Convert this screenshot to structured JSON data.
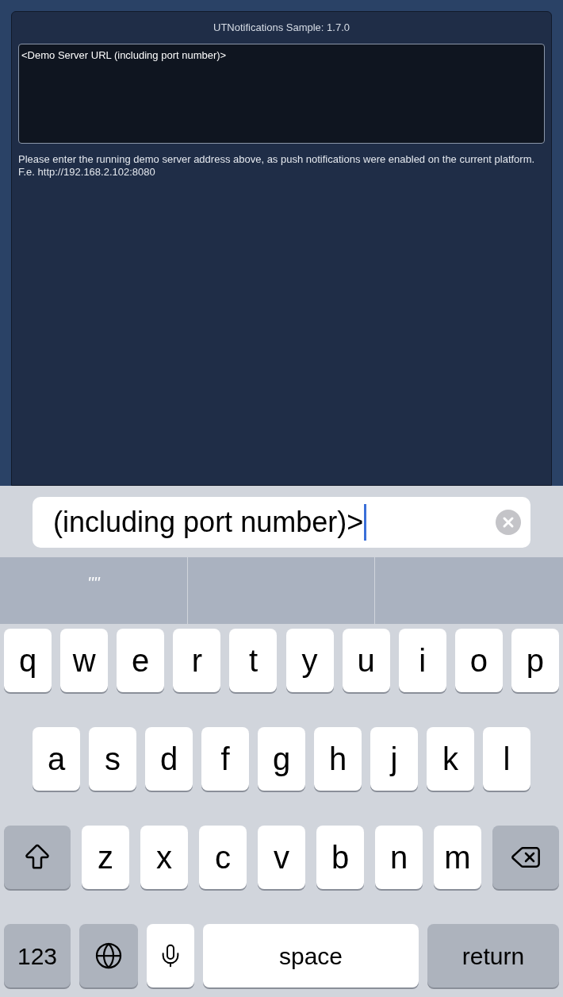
{
  "window": {
    "title": "UTNotifications Sample: 1.7.0"
  },
  "server_field": {
    "value": "<Demo Server URL (including port number)>"
  },
  "hint": "Please enter the running demo server address above, as push notifications were enabled on the current platform. F.e. http://192.168.2.102:8080",
  "keyboard_input": {
    "value": "(including port number)>",
    "focused": true
  },
  "suggestions": [
    "\"\""
  ],
  "keys": [
    [
      {
        "kind": "letter",
        "label": "q"
      },
      {
        "kind": "letter",
        "label": "w"
      },
      {
        "kind": "letter",
        "label": "e"
      },
      {
        "kind": "letter",
        "label": "r"
      },
      {
        "kind": "letter",
        "label": "t"
      },
      {
        "kind": "letter",
        "label": "y"
      },
      {
        "kind": "letter",
        "label": "u"
      },
      {
        "kind": "letter",
        "label": "i"
      },
      {
        "kind": "letter",
        "label": "o"
      },
      {
        "kind": "letter",
        "label": "p"
      }
    ],
    [
      {
        "kind": "letter",
        "label": "a"
      },
      {
        "kind": "letter",
        "label": "s"
      },
      {
        "kind": "letter",
        "label": "d"
      },
      {
        "kind": "letter",
        "label": "f"
      },
      {
        "kind": "letter",
        "label": "g"
      },
      {
        "kind": "letter",
        "label": "h"
      },
      {
        "kind": "letter",
        "label": "j"
      },
      {
        "kind": "letter",
        "label": "k"
      },
      {
        "kind": "letter",
        "label": "l"
      }
    ],
    [
      {
        "kind": "shift"
      },
      {
        "kind": "letter",
        "label": "z"
      },
      {
        "kind": "letter",
        "label": "x"
      },
      {
        "kind": "letter",
        "label": "c"
      },
      {
        "kind": "letter",
        "label": "v"
      },
      {
        "kind": "letter",
        "label": "b"
      },
      {
        "kind": "letter",
        "label": "n"
      },
      {
        "kind": "letter",
        "label": "m"
      },
      {
        "kind": "delete"
      }
    ],
    [
      {
        "kind": "numbers",
        "label": "123"
      },
      {
        "kind": "globe"
      },
      {
        "kind": "mic"
      },
      {
        "kind": "space",
        "label": "space"
      },
      {
        "kind": "return",
        "label": "return"
      }
    ]
  ]
}
